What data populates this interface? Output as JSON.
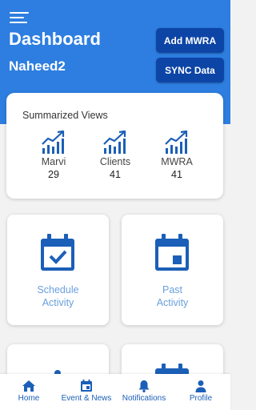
{
  "header": {
    "title": "Dashboard",
    "username": "Naheed2",
    "add_button": "Add MWRA",
    "sync_button": "SYNC Data"
  },
  "summary": {
    "title": "Summarized Views",
    "stats": [
      {
        "label": "Marvi",
        "value": "29",
        "icon": "trending-up-icon"
      },
      {
        "label": "Clients",
        "value": "41",
        "icon": "trending-up-icon"
      },
      {
        "label": "MWRA",
        "value": "41",
        "icon": "trending-up-icon"
      }
    ]
  },
  "cards": [
    {
      "line1": "Schedule",
      "line2": "Activity",
      "icon": "calendar-check-icon"
    },
    {
      "line1": "Past",
      "line2": "Activity",
      "icon": "calendar-day-icon"
    }
  ],
  "nav": [
    {
      "label": "Home",
      "icon": "home-icon"
    },
    {
      "label": "Event & News",
      "icon": "calendar-icon"
    },
    {
      "label": "Notifications",
      "icon": "bell-icon"
    },
    {
      "label": "Profile",
      "icon": "user-icon"
    }
  ],
  "colors": {
    "header": "#2d7ee0",
    "button": "#0d45a6",
    "icon": "#1b5fb8",
    "card_label": "#6aa0dc"
  }
}
